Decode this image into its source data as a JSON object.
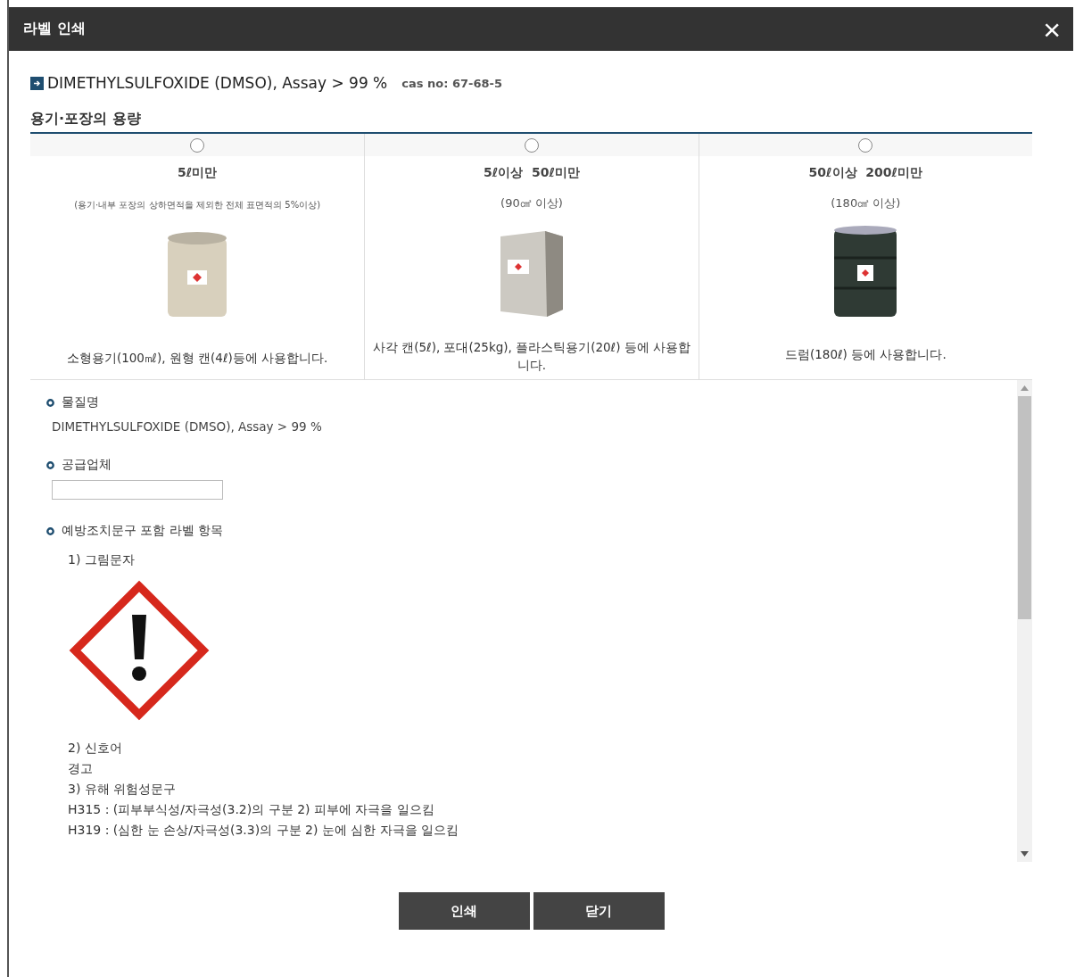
{
  "window": {
    "title": "라벨 인쇄",
    "close": "×"
  },
  "substance": {
    "name": "DIMETHYLSULFOXIDE (DMSO), Assay > 99 %",
    "cas": "cas no: 67-68-5"
  },
  "capacity": {
    "title": "용기·포장의 용량",
    "options": [
      {
        "label": "5ℓ미만",
        "note": "(용기·내부 포장의 상하면적을 제외한 전체 표면적의 5%이상)",
        "kind": "can",
        "usage": "소형용기(100㎖), 원형 캔(4ℓ)등에 사용합니다.",
        "selected": false
      },
      {
        "label": "5ℓ이상  50ℓ미만",
        "note": "(90㎠ 이상)",
        "kind": "square",
        "usage": "사각 캔(5ℓ), 포대(25kg), 플라스틱용기(20ℓ) 등에 사용합니다.",
        "selected": false
      },
      {
        "label": "50ℓ이상  200ℓ미만",
        "note": "(180㎠ 이상)",
        "kind": "drum",
        "usage": "드럼(180ℓ) 등에 사용합니다.",
        "selected": false
      }
    ]
  },
  "details": {
    "sections": [
      {
        "title": "물질명",
        "kind": "text",
        "text": "DIMETHYLSULFOXIDE (DMSO), Assay > 99 %"
      },
      {
        "title": "공급업체",
        "kind": "field"
      },
      {
        "title": "예방조치문구 포함 라벨 항목",
        "kind": "items",
        "items": [
          {
            "kind": "heading",
            "text": "1) 그림문자"
          },
          {
            "kind": "pictogram"
          },
          {
            "kind": "heading",
            "text": "2) 신호어"
          },
          {
            "kind": "line",
            "text": "경고"
          },
          {
            "kind": "heading",
            "text": "3) 유해 위험성문구"
          },
          {
            "kind": "line",
            "text": "H315 : (피부부식성/자극성(3.2)의 구분 2) 피부에 자극을 일으킴"
          },
          {
            "kind": "line",
            "text": "H319 : (심한 눈 손상/자극성(3.3)의 구분 2) 눈에 심한 자극을 일으킴"
          }
        ]
      }
    ]
  },
  "buttons": [
    {
      "label": "인쇄"
    },
    {
      "label": "닫기"
    }
  ]
}
